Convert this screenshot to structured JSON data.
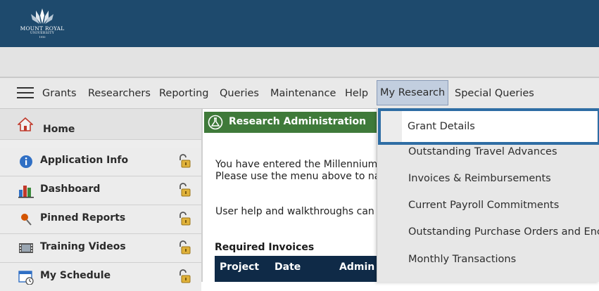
{
  "brand": {
    "name": "MOUNT ROYAL",
    "sub": "UNIVERSITY",
    "year": "1910",
    "color_banner": "#1e4a6d"
  },
  "menubar": {
    "items": [
      "Grants",
      "Researchers",
      "Reporting",
      "Queries",
      "Maintenance",
      "Help",
      "My Research",
      "Special Queries"
    ]
  },
  "sidebar": {
    "home": "Home",
    "items": [
      {
        "label": "Application Info",
        "icon": "info-icon"
      },
      {
        "label": "Dashboard",
        "icon": "bar-chart-icon"
      },
      {
        "label": "Pinned Reports",
        "icon": "pin-icon"
      },
      {
        "label": "Training Videos",
        "icon": "film-icon"
      },
      {
        "label": "My Schedule",
        "icon": "calendar-icon"
      }
    ]
  },
  "main": {
    "panel_title": "Research Administration",
    "line1": "You have entered the Millennium",
    "line2": "Please use the menu above to na",
    "line3": "User help and walkthroughs can",
    "section_title": "Required Invoices",
    "table_headers": [
      "Project",
      "Date",
      "Admin"
    ],
    "header_color": "#3f7a3a",
    "table_header_color": "#0f2a47"
  },
  "dropdown": {
    "highlighted": "Grant Details",
    "items": [
      "Outstanding Travel Advances",
      "Invoices & Reimbursements",
      "Current Payroll Commitments",
      "Outstanding Purchase Orders and Encu",
      "Monthly Transactions"
    ],
    "highlight_color": "#2e6da4"
  }
}
